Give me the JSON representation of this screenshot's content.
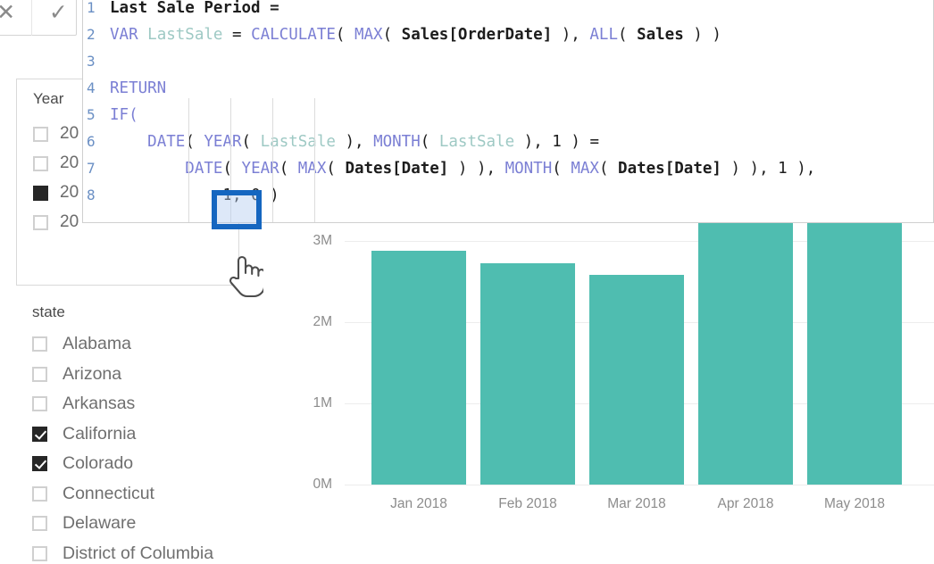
{
  "formula_bar": {
    "cancel_icon": "close-icon",
    "cancel_glyph": "✕",
    "commit_icon": "checkmark-icon",
    "commit_glyph": "✓"
  },
  "code_editor": {
    "lines": [
      {
        "num": "1",
        "tokens": [
          {
            "t": "Last Sale Period =",
            "c": "tbl"
          }
        ]
      },
      {
        "num": "2",
        "tokens": [
          {
            "t": "VAR ",
            "c": "kw"
          },
          {
            "t": "LastSale ",
            "c": "var"
          },
          {
            "t": "= ",
            "c": "pln"
          },
          {
            "t": "CALCULATE",
            "c": "fn"
          },
          {
            "t": "( ",
            "c": "pln"
          },
          {
            "t": "MAX",
            "c": "fn"
          },
          {
            "t": "( ",
            "c": "pln"
          },
          {
            "t": "Sales[OrderDate]",
            "c": "tbl"
          },
          {
            "t": " ), ",
            "c": "pln"
          },
          {
            "t": "ALL",
            "c": "fn"
          },
          {
            "t": "( ",
            "c": "pln"
          },
          {
            "t": "Sales",
            "c": "tbl"
          },
          {
            "t": " ) )",
            "c": "pln"
          }
        ]
      },
      {
        "num": "3",
        "tokens": []
      },
      {
        "num": "4",
        "tokens": [
          {
            "t": "RETURN",
            "c": "kw"
          }
        ]
      },
      {
        "num": "5",
        "tokens": [
          {
            "t": "IF(",
            "c": "kw"
          }
        ]
      },
      {
        "num": "6",
        "tokens": [
          {
            "t": "    ",
            "c": "pln"
          },
          {
            "t": "DATE",
            "c": "fn"
          },
          {
            "t": "( ",
            "c": "pln"
          },
          {
            "t": "YEAR",
            "c": "fn"
          },
          {
            "t": "( ",
            "c": "pln"
          },
          {
            "t": "LastSale",
            "c": "var"
          },
          {
            "t": " ), ",
            "c": "pln"
          },
          {
            "t": "MONTH",
            "c": "fn"
          },
          {
            "t": "( ",
            "c": "pln"
          },
          {
            "t": "LastSale",
            "c": "var"
          },
          {
            "t": " ), ",
            "c": "pln"
          },
          {
            "t": "1",
            "c": "num"
          },
          {
            "t": " ) =",
            "c": "pln"
          }
        ]
      },
      {
        "num": "7",
        "tokens": [
          {
            "t": "        ",
            "c": "pln"
          },
          {
            "t": "DATE",
            "c": "fn"
          },
          {
            "t": "( ",
            "c": "pln"
          },
          {
            "t": "YEAR",
            "c": "fn"
          },
          {
            "t": "( ",
            "c": "pln"
          },
          {
            "t": "MAX",
            "c": "fn"
          },
          {
            "t": "( ",
            "c": "pln"
          },
          {
            "t": "Dates[Date]",
            "c": "tbl"
          },
          {
            "t": " ) ), ",
            "c": "pln"
          },
          {
            "t": "MONTH",
            "c": "fn"
          },
          {
            "t": "( ",
            "c": "pln"
          },
          {
            "t": "MAX",
            "c": "fn"
          },
          {
            "t": "( ",
            "c": "pln"
          },
          {
            "t": "Dates[Date]",
            "c": "tbl"
          },
          {
            "t": " ) ), ",
            "c": "pln"
          },
          {
            "t": "1",
            "c": "num"
          },
          {
            "t": " ),",
            "c": "pln"
          }
        ]
      },
      {
        "num": "8",
        "tokens": [
          {
            "t": "            ",
            "c": "pln"
          },
          {
            "t": "1",
            "c": "num"
          },
          {
            "t": ", ",
            "c": "pln"
          },
          {
            "t": "0",
            "c": "num"
          },
          {
            "t": " )",
            "c": "pln"
          }
        ]
      }
    ],
    "selection": {
      "text": "1,",
      "highlight_color": "#1566c0"
    }
  },
  "year_slicer": {
    "title": "Year",
    "items": [
      {
        "label": "20",
        "state": "unchecked"
      },
      {
        "label": "20",
        "state": "unchecked"
      },
      {
        "label": "20",
        "state": "filled"
      },
      {
        "label": "20",
        "state": "unchecked"
      }
    ]
  },
  "state_slicer": {
    "title": "state",
    "items": [
      {
        "label": "Alabama",
        "state": "unchecked"
      },
      {
        "label": "Arizona",
        "state": "unchecked"
      },
      {
        "label": "Arkansas",
        "state": "unchecked"
      },
      {
        "label": "California",
        "state": "checked"
      },
      {
        "label": "Colorado",
        "state": "checked"
      },
      {
        "label": "Connecticut",
        "state": "unchecked"
      },
      {
        "label": "Delaware",
        "state": "unchecked"
      },
      {
        "label": "District of Columbia",
        "state": "unchecked"
      }
    ]
  },
  "cursor": {
    "icon": "hand-pointer-cursor"
  },
  "chart_data": {
    "type": "bar",
    "categories": [
      "Jan 2018",
      "Feb 2018",
      "Mar 2018",
      "Apr 2018",
      "May 2018"
    ],
    "values": [
      2.88,
      2.72,
      2.58,
      3.25,
      3.22
    ],
    "value_unit": "M",
    "title": "",
    "xlabel": "",
    "ylabel": "",
    "ylim": [
      0,
      3.25
    ],
    "yticks": [
      0,
      1,
      2,
      3
    ],
    "ytick_labels": [
      "0M",
      "1M",
      "2M",
      "3M"
    ],
    "grid": true,
    "legend": "none",
    "bar_color": "#4fbdb0",
    "note": "Apr 2018 and May 2018 bars are clipped by the top edge of the visible chart area"
  }
}
